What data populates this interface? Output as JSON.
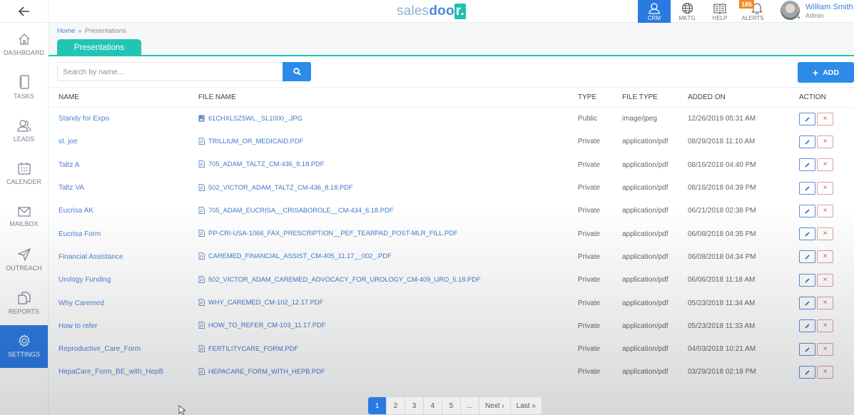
{
  "app": {
    "logo": {
      "part1": "sales",
      "part2": "doo",
      "part3": "r."
    }
  },
  "topnav": [
    {
      "key": "crm",
      "label": "CRM",
      "icon": "user-icon",
      "active": true
    },
    {
      "key": "mktg",
      "label": "MKTG",
      "icon": "globe-icon",
      "active": false
    },
    {
      "key": "help",
      "label": "HELP",
      "icon": "book-icon",
      "active": false
    },
    {
      "key": "alerts",
      "label": "ALERTS",
      "icon": "bell-icon",
      "active": false,
      "badge": "186"
    }
  ],
  "user": {
    "name": "William Smith",
    "role": "Admin"
  },
  "sidebar": {
    "items": [
      {
        "label": "DASHBOARD",
        "icon": "home-icon"
      },
      {
        "label": "TASKS",
        "icon": "notebook-icon"
      },
      {
        "label": "LEADS",
        "icon": "users-icon"
      },
      {
        "label": "CALENDER",
        "icon": "calendar-icon"
      },
      {
        "label": "MAILBOX",
        "icon": "mail-icon"
      },
      {
        "label": "OUTREACH",
        "icon": "send-icon"
      },
      {
        "label": "REPORTS",
        "icon": "reports-icon"
      },
      {
        "label": "SETTINGS",
        "icon": "gear-icon",
        "active": true
      }
    ]
  },
  "breadcrumb": {
    "home": "Home",
    "separator": "»",
    "current": "Presentations"
  },
  "tab": {
    "label": "Presentations"
  },
  "search": {
    "placeholder": "Search by name...",
    "value": ""
  },
  "add_button": {
    "label": "ADD"
  },
  "table": {
    "headers": [
      "NAME",
      "FILE NAME",
      "TYPE",
      "FILE TYPE",
      "ADDED ON",
      "ACTION"
    ],
    "rows": [
      {
        "name": "Standy for Expo",
        "file": "61CHXLSZ5WL._SL1000_.JPG",
        "file_icon": "image-file-icon",
        "type": "Public",
        "file_type": "image/jpeg",
        "added": "12/26/2019 05:31 AM"
      },
      {
        "name": "st. joe",
        "file": "TRILLIUM_OR_MEDICAID.PDF",
        "file_icon": "pdf-file-icon",
        "type": "Private",
        "file_type": "application/pdf",
        "added": "08/29/2018 11:10 AM"
      },
      {
        "name": "Taltz A",
        "file": "705_ADAM_TALTZ_CM-436_8.18.PDF",
        "file_icon": "pdf-file-icon",
        "type": "Private",
        "file_type": "application/pdf",
        "added": "08/16/2018 04:40 PM"
      },
      {
        "name": "Taltz VA",
        "file": "502_VICTOR_ADAM_TALTZ_CM-436_8.18.PDF",
        "file_icon": "pdf-file-icon",
        "type": "Private",
        "file_type": "application/pdf",
        "added": "08/16/2018 04:39 PM"
      },
      {
        "name": "Eucrisa AK",
        "file": "705_ADAM_EUCRISA__CRISABOROLE__CM-434_6.18.PDF",
        "file_icon": "pdf-file-icon",
        "type": "Private",
        "file_type": "application/pdf",
        "added": "06/21/2018 02:38 PM"
      },
      {
        "name": "Eucrisa Form",
        "file": "PP-CRI-USA-1066_FAX_PRESCRIPTION__PEF_TEARPAD_POST-MLR_FILL.PDF",
        "file_icon": "pdf-file-icon",
        "type": "Private",
        "file_type": "application/pdf",
        "added": "06/08/2018 04:35 PM"
      },
      {
        "name": "Financial Assistance",
        "file": "CAREMED_FINANCIAL_ASSIST_CM-405_11.17__002_.PDF",
        "file_icon": "pdf-file-icon",
        "type": "Private",
        "file_type": "application/pdf",
        "added": "06/08/2018 04:34 PM"
      },
      {
        "name": "Urology Funding",
        "file": "502_VICTOR_ADAM_CAREMED_ADVOCACY_FOR_UROLOGY_CM-409_URO_5.18.PDF",
        "file_icon": "pdf-file-icon",
        "type": "Private",
        "file_type": "application/pdf",
        "added": "06/06/2018 11:18 AM"
      },
      {
        "name": "Why Caremed",
        "file": "WHY_CAREMED_CM-102_12.17.PDF",
        "file_icon": "pdf-file-icon",
        "type": "Private",
        "file_type": "application/pdf",
        "added": "05/23/2018 11:34 AM"
      },
      {
        "name": "How to refer",
        "file": "HOW_TO_REFER_CM-103_11.17.PDF",
        "file_icon": "pdf-file-icon",
        "type": "Private",
        "file_type": "application/pdf",
        "added": "05/23/2018 11:33 AM"
      },
      {
        "name": "Reproductive_Care_Form",
        "file": "FERTILITYCARE_FORM.PDF",
        "file_icon": "pdf-file-icon",
        "type": "Private",
        "file_type": "application/pdf",
        "added": "04/03/2018 10:21 AM"
      },
      {
        "name": "HepaCare_Form_BE_with_HepB",
        "file": "HEPACARE_FORM_WITH_HEPB.PDF",
        "file_icon": "pdf-file-icon",
        "type": "Private",
        "file_type": "application/pdf",
        "added": "03/29/2018 02:18 PM"
      }
    ]
  },
  "pagination": {
    "pages": [
      "1",
      "2",
      "3",
      "4",
      "5",
      "..."
    ],
    "current": "1",
    "next": "Next ›",
    "last": "Last »"
  },
  "colors": {
    "accent": "#2a7ae2",
    "teal": "#22c5b3",
    "link": "#4c84d0",
    "badge": "#f08a24"
  }
}
